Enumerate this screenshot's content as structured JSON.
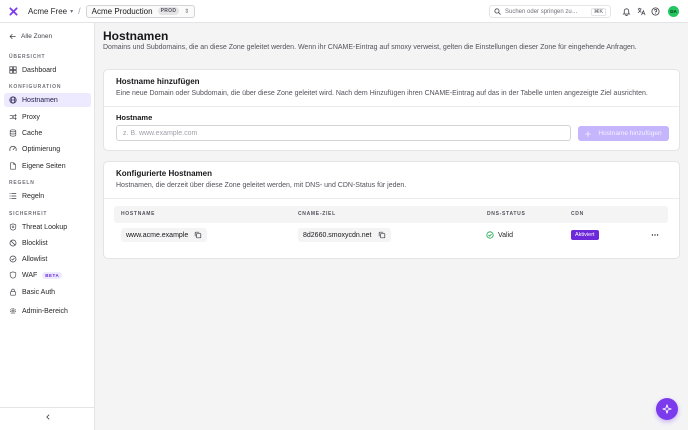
{
  "topbar": {
    "logo_icon": "smoxy-x-icon",
    "account": "Acme Free",
    "zone": "Acme Production",
    "zone_badge": "PROD",
    "search_placeholder": "Suchen oder springen zu…",
    "search_shortcut": "⌘K",
    "avatar_initials": "DA",
    "icons": [
      "bell-icon",
      "translate-icon",
      "help-icon"
    ]
  },
  "sidebar": {
    "back_label": "Alle Zonen",
    "sections": {
      "overview": "ÜBERSICHT",
      "configuration": "KONFIGURATION",
      "rules": "REGELN",
      "security": "SICHERHEIT"
    },
    "items": {
      "dashboard": "Dashboard",
      "hostnames": "Hostnamen",
      "proxy": "Proxy",
      "cache": "Cache",
      "optimization": "Optimierung",
      "custom_pages": "Eigene Seiten",
      "rules": "Regeln",
      "threat_lookup": "Threat Lookup",
      "blocklist": "Blocklist",
      "allowlist": "Allowlist",
      "waf": "WAF",
      "waf_badge": "BETA",
      "basic_auth": "Basic Auth",
      "admin": "Admin-Bereich"
    },
    "active_item": "Hostnamen"
  },
  "page": {
    "title": "Hostnamen",
    "subtitle": "Domains und Subdomains, die an diese Zone geleitet werden. Wenn ihr CNAME-Eintrag auf smoxy verweist, gelten die Einstellungen dieser Zone für eingehende Anfragen."
  },
  "add_card": {
    "title": "Hostname hinzufügen",
    "description": "Eine neue Domain oder Subdomain, die über diese Zone geleitet wird. Nach dem Hinzufügen ihren CNAME-Eintrag auf das in der Tabelle unten angezeigte Ziel ausrichten.",
    "field_label": "Hostname",
    "input_value": "",
    "input_placeholder": "z. B. www.example.com",
    "button_label": "Hostname hinzufügen"
  },
  "list_card": {
    "title": "Konfigurierte Hostnamen",
    "description": "Hostnamen, die derzeit über diese Zone geleitet werden, mit DNS- und CDN-Status für jeden.",
    "columns": {
      "hostname": "HOSTNAME",
      "cname": "CNAME-ZIEL",
      "dns": "DNS-STATUS",
      "cdn": "CDN"
    },
    "rows": [
      {
        "hostname": "www.acme.example",
        "cname_target": "8d2660.smoxycdn.net",
        "dns_status": "Valid",
        "cdn": "Aktiviert"
      }
    ]
  },
  "colors": {
    "accent": "#7c3aed",
    "accent_light": "#ede9fe",
    "valid_green": "#16a34a",
    "avatar_green": "#22c55e"
  }
}
